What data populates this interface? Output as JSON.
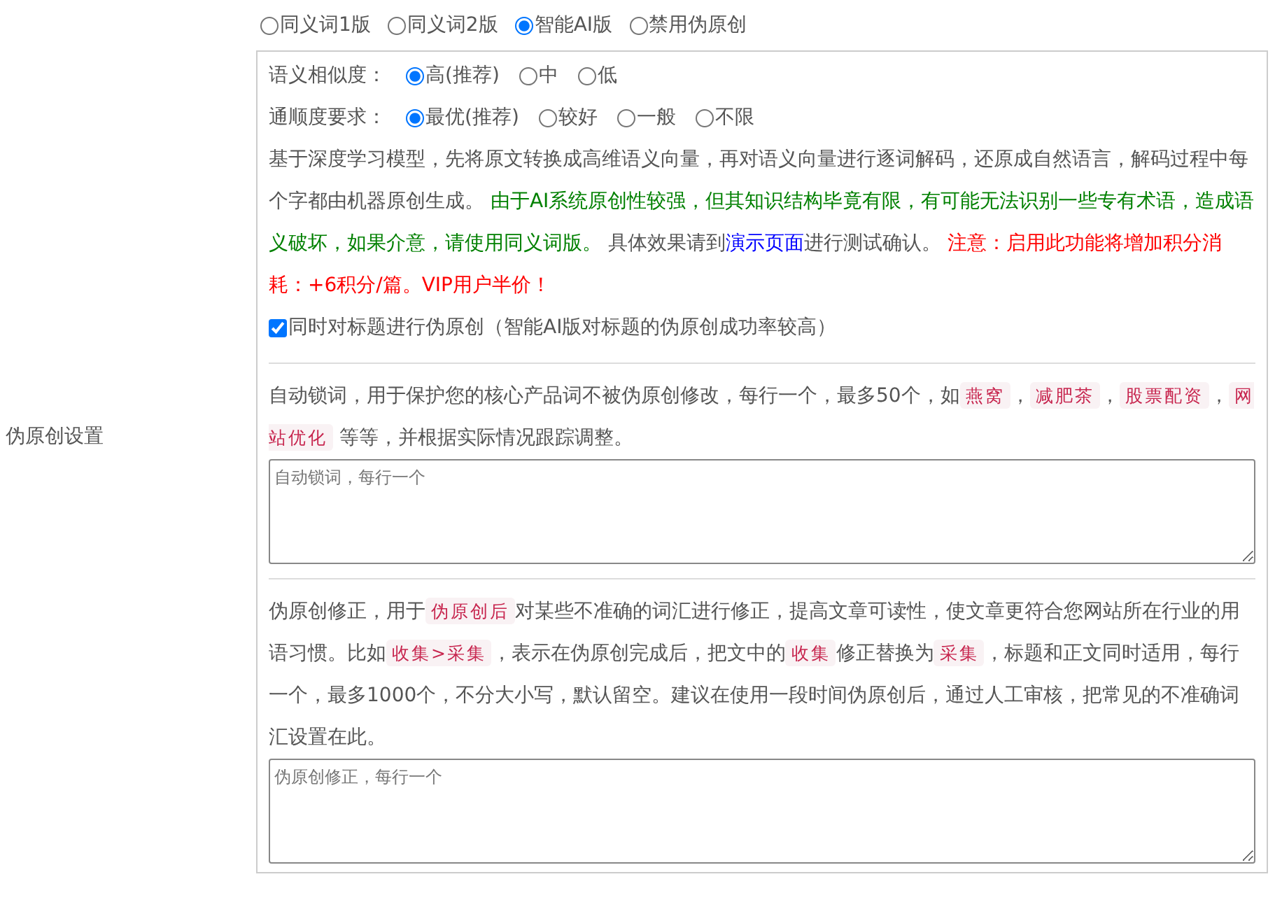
{
  "setting_label": "伪原创设置",
  "versions": [
    {
      "label": "同义词1版",
      "selected": false
    },
    {
      "label": "同义词2版",
      "selected": false
    },
    {
      "label": "智能AI版",
      "selected": true
    },
    {
      "label": "禁用伪原创",
      "selected": false
    }
  ],
  "similarity": {
    "label": "语义相似度：",
    "options": [
      {
        "label": "高(推荐)",
        "selected": true
      },
      {
        "label": "中",
        "selected": false
      },
      {
        "label": "低",
        "selected": false
      }
    ]
  },
  "fluency": {
    "label": "通顺度要求：",
    "options": [
      {
        "label": "最优(推荐)",
        "selected": true
      },
      {
        "label": "较好",
        "selected": false
      },
      {
        "label": "一般",
        "selected": false
      },
      {
        "label": "不限",
        "selected": false
      }
    ]
  },
  "ai_description": [
    {
      "kind": "text",
      "text": "基于深度学习模型，先将原文转换成高维语义向量，再对语义向量进行逐词解码，还原成自然语言，解码过程中每个字都由机器原创生成。 "
    },
    {
      "kind": "success",
      "text": "由于AI系统原创性较强，但其知识结构毕竟有限，有可能无法识别一些专有术语，造成语义破坏，如果介意，请使用同义词版。"
    },
    {
      "kind": "text",
      "text": " 具体效果请到"
    },
    {
      "kind": "link",
      "text": "演示页面"
    },
    {
      "kind": "text",
      "text": "进行测试确认。 "
    },
    {
      "kind": "warning",
      "text": "注意：启用此功能将增加积分消耗：+6积分/篇。VIP用户半价！"
    }
  ],
  "title_option": {
    "label": "同时对标题进行伪原创（智能AI版对标题的伪原创成功率较高）",
    "checked": true
  },
  "lock_words": {
    "description": [
      {
        "kind": "text",
        "text": "自动锁词，用于保护您的核心产品词不被伪原创修改，每行一个，最多50个，如"
      },
      {
        "kind": "code",
        "text": "燕窝"
      },
      {
        "kind": "text",
        "text": "，"
      },
      {
        "kind": "code",
        "text": "减肥茶"
      },
      {
        "kind": "text",
        "text": "，"
      },
      {
        "kind": "code",
        "text": "股票配资"
      },
      {
        "kind": "text",
        "text": "，"
      },
      {
        "kind": "code",
        "text": "网站优化"
      },
      {
        "kind": "text",
        "text": " 等等，并根据实际情况跟踪调整。"
      }
    ],
    "placeholder": "自动锁词，每行一个"
  },
  "corrections": {
    "description": [
      {
        "kind": "text",
        "text": "伪原创修正，用于"
      },
      {
        "kind": "code",
        "text": "伪原创后"
      },
      {
        "kind": "text",
        "text": "对某些不准确的词汇进行修正，提高文章可读性，使文章更符合您网站所在行业的用语习惯。比如"
      },
      {
        "kind": "code",
        "text": "收集>采集"
      },
      {
        "kind": "text",
        "text": "，表示在伪原创完成后，把文中的"
      },
      {
        "kind": "code",
        "text": "收集"
      },
      {
        "kind": "text",
        "text": "修正替换为"
      },
      {
        "kind": "code",
        "text": "采集"
      },
      {
        "kind": "text",
        "text": "，标题和正文同时适用，每行一个，最多1000个，不分大小写，默认留空。建议在使用一段时间伪原创后，通过人工审核，把常见的不准确词汇设置在此。"
      }
    ],
    "placeholder": "伪原创修正，每行一个"
  }
}
